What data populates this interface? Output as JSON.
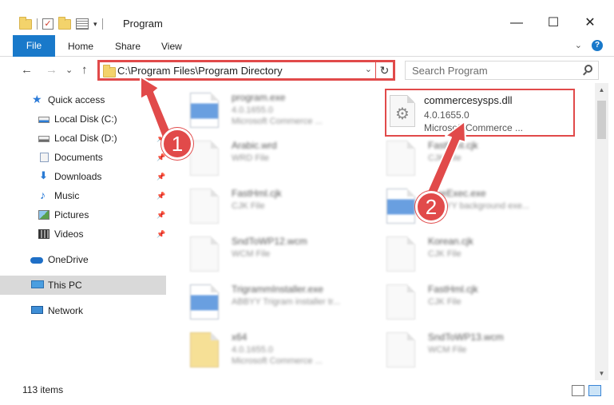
{
  "window": {
    "title": "Program",
    "qat_dropdown": "▾",
    "controls": {
      "minimize": "—",
      "maximize": "☐",
      "close": "✕"
    }
  },
  "ribbon": {
    "tabs": [
      "File",
      "Home",
      "Share",
      "View"
    ],
    "expand": "⌄",
    "help": "?"
  },
  "address": {
    "back": "←",
    "forward": "→",
    "recent": "⌄",
    "up": "↑",
    "path": "C:\\Program Files\\Program Directory",
    "chevron": "⌄",
    "refresh": "↻"
  },
  "search": {
    "placeholder": "Search Program"
  },
  "sidebar": {
    "items": [
      {
        "label": "Quick access",
        "icon": "star-icon"
      },
      {
        "label": "Local Disk (C:)",
        "icon": "drive-icon",
        "pinned": true
      },
      {
        "label": "Local Disk (D:)",
        "icon": "drive-icon",
        "pinned": true
      },
      {
        "label": "Documents",
        "icon": "documents-icon",
        "pinned": true
      },
      {
        "label": "Downloads",
        "icon": "downloads-icon",
        "pinned": true
      },
      {
        "label": "Music",
        "icon": "music-icon",
        "pinned": true
      },
      {
        "label": "Pictures",
        "icon": "pictures-icon",
        "pinned": true
      },
      {
        "label": "Videos",
        "icon": "videos-icon",
        "pinned": true
      },
      {
        "label": "OneDrive",
        "icon": "onedrive-icon"
      },
      {
        "label": "This PC",
        "icon": "computer-icon",
        "selected": true
      },
      {
        "label": "Network",
        "icon": "network-icon"
      }
    ],
    "pin_glyph": "📌"
  },
  "files": [
    {
      "name": "program.exe",
      "meta1": "4.0.1655.0",
      "meta2": "Microsoft Commerce ...",
      "icon": "exe"
    },
    {
      "name": "commercesysps.dll",
      "meta1": "4.0.1655.0",
      "meta2": "Microsoft Commerce ...",
      "icon": "gear",
      "highlighted": true
    },
    {
      "name": "Arabic.wrd",
      "meta1": "WRD File",
      "meta2": "",
      "icon": "blank"
    },
    {
      "name": "FastHml.cjk",
      "meta1": "CJK File",
      "meta2": "",
      "icon": "blank"
    },
    {
      "name": "FastHml.cjk",
      "meta1": "CJK File",
      "meta2": "",
      "icon": "blank"
    },
    {
      "name": "FineExec.exe",
      "meta1": "ABBYY background exe...",
      "meta2": "",
      "icon": "exe"
    },
    {
      "name": "SndToWP12.wcm",
      "meta1": "WCM File",
      "meta2": "",
      "icon": "blank"
    },
    {
      "name": "Korean.cjk",
      "meta1": "CJK File",
      "meta2": "",
      "icon": "blank"
    },
    {
      "name": "TrigrammInstaller.exe",
      "meta1": "ABBYY Trigram installer tr...",
      "meta2": "",
      "icon": "exe"
    },
    {
      "name": "FastHml.cjk",
      "meta1": "CJK File",
      "meta2": "",
      "icon": "blank"
    },
    {
      "name": "x64",
      "meta1": "4.0.1655.0",
      "meta2": "Microsoft Commerce ...",
      "icon": "folder"
    },
    {
      "name": "SndToWP13.wcm",
      "meta1": "WCM File",
      "meta2": "",
      "icon": "blank"
    }
  ],
  "status": {
    "items": "113 items"
  },
  "annotations": {
    "step1": "1",
    "step2": "2",
    "color": "#e14a4a"
  },
  "colors": {
    "accent": "#1979ca",
    "highlight": "#e14a4a",
    "selected_bg": "#d9d9d9"
  }
}
